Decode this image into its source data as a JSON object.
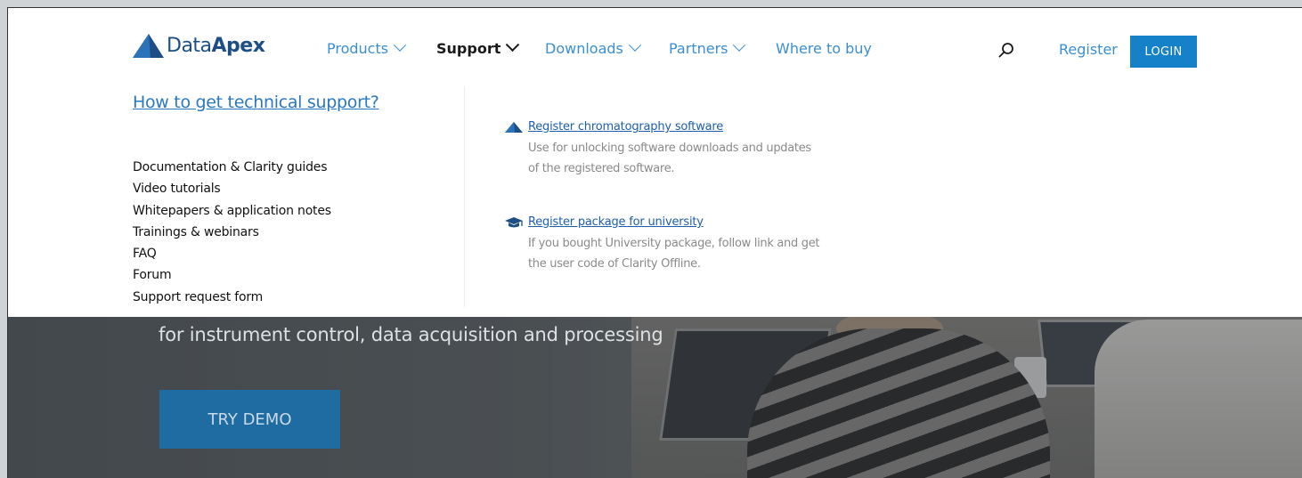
{
  "brand": {
    "name_regular": "Data",
    "name_bold": "Apex",
    "logo_icon": "dataapex-triangle-logo",
    "color": "#1d4f86"
  },
  "nav": {
    "items": [
      {
        "label": "Products",
        "has_dropdown": true,
        "active": false
      },
      {
        "label": "Support",
        "has_dropdown": true,
        "active": true
      },
      {
        "label": "Downloads",
        "has_dropdown": true,
        "active": false
      },
      {
        "label": "Partners",
        "has_dropdown": true,
        "active": false
      },
      {
        "label": "Where to buy",
        "has_dropdown": false,
        "active": false
      }
    ],
    "search_icon": "search-icon",
    "register_label": "Register",
    "login_label": "LOGIN",
    "accent_color": "#1481c9"
  },
  "support_menu": {
    "heading": "How to get technical support?",
    "links": [
      "Documentation & Clarity guides",
      "Video tutorials",
      "Whitepapers & application notes",
      "Trainings & webinars",
      "FAQ",
      "Forum",
      "Support request form"
    ],
    "features": [
      {
        "icon": "dataapex-triangle-icon",
        "title": "Register chromatography software",
        "description": "Use for unlocking software downloads and updates of the registered software."
      },
      {
        "icon": "graduation-cap-icon",
        "title": "Register package for university",
        "description": "If you bought University package, follow link and get the user code of Clarity Offline."
      }
    ]
  },
  "hero": {
    "subtitle": "for instrument control, data acquisition and processing",
    "cta_label": "TRY DEMO"
  }
}
